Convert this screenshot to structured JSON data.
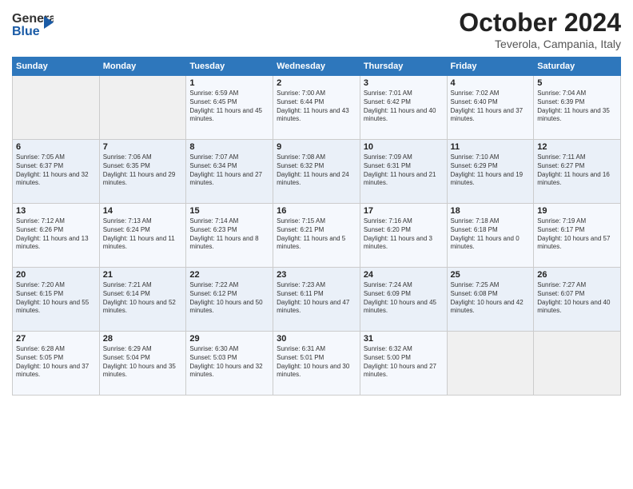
{
  "header": {
    "logo_line1": "General",
    "logo_line2": "Blue",
    "month": "October 2024",
    "location": "Teverola, Campania, Italy"
  },
  "days_of_week": [
    "Sunday",
    "Monday",
    "Tuesday",
    "Wednesday",
    "Thursday",
    "Friday",
    "Saturday"
  ],
  "weeks": [
    [
      {
        "day": "",
        "sunrise": "",
        "sunset": "",
        "daylight": ""
      },
      {
        "day": "",
        "sunrise": "",
        "sunset": "",
        "daylight": ""
      },
      {
        "day": "1",
        "sunrise": "Sunrise: 6:59 AM",
        "sunset": "Sunset: 6:45 PM",
        "daylight": "Daylight: 11 hours and 45 minutes."
      },
      {
        "day": "2",
        "sunrise": "Sunrise: 7:00 AM",
        "sunset": "Sunset: 6:44 PM",
        "daylight": "Daylight: 11 hours and 43 minutes."
      },
      {
        "day": "3",
        "sunrise": "Sunrise: 7:01 AM",
        "sunset": "Sunset: 6:42 PM",
        "daylight": "Daylight: 11 hours and 40 minutes."
      },
      {
        "day": "4",
        "sunrise": "Sunrise: 7:02 AM",
        "sunset": "Sunset: 6:40 PM",
        "daylight": "Daylight: 11 hours and 37 minutes."
      },
      {
        "day": "5",
        "sunrise": "Sunrise: 7:04 AM",
        "sunset": "Sunset: 6:39 PM",
        "daylight": "Daylight: 11 hours and 35 minutes."
      }
    ],
    [
      {
        "day": "6",
        "sunrise": "Sunrise: 7:05 AM",
        "sunset": "Sunset: 6:37 PM",
        "daylight": "Daylight: 11 hours and 32 minutes."
      },
      {
        "day": "7",
        "sunrise": "Sunrise: 7:06 AM",
        "sunset": "Sunset: 6:35 PM",
        "daylight": "Daylight: 11 hours and 29 minutes."
      },
      {
        "day": "8",
        "sunrise": "Sunrise: 7:07 AM",
        "sunset": "Sunset: 6:34 PM",
        "daylight": "Daylight: 11 hours and 27 minutes."
      },
      {
        "day": "9",
        "sunrise": "Sunrise: 7:08 AM",
        "sunset": "Sunset: 6:32 PM",
        "daylight": "Daylight: 11 hours and 24 minutes."
      },
      {
        "day": "10",
        "sunrise": "Sunrise: 7:09 AM",
        "sunset": "Sunset: 6:31 PM",
        "daylight": "Daylight: 11 hours and 21 minutes."
      },
      {
        "day": "11",
        "sunrise": "Sunrise: 7:10 AM",
        "sunset": "Sunset: 6:29 PM",
        "daylight": "Daylight: 11 hours and 19 minutes."
      },
      {
        "day": "12",
        "sunrise": "Sunrise: 7:11 AM",
        "sunset": "Sunset: 6:27 PM",
        "daylight": "Daylight: 11 hours and 16 minutes."
      }
    ],
    [
      {
        "day": "13",
        "sunrise": "Sunrise: 7:12 AM",
        "sunset": "Sunset: 6:26 PM",
        "daylight": "Daylight: 11 hours and 13 minutes."
      },
      {
        "day": "14",
        "sunrise": "Sunrise: 7:13 AM",
        "sunset": "Sunset: 6:24 PM",
        "daylight": "Daylight: 11 hours and 11 minutes."
      },
      {
        "day": "15",
        "sunrise": "Sunrise: 7:14 AM",
        "sunset": "Sunset: 6:23 PM",
        "daylight": "Daylight: 11 hours and 8 minutes."
      },
      {
        "day": "16",
        "sunrise": "Sunrise: 7:15 AM",
        "sunset": "Sunset: 6:21 PM",
        "daylight": "Daylight: 11 hours and 5 minutes."
      },
      {
        "day": "17",
        "sunrise": "Sunrise: 7:16 AM",
        "sunset": "Sunset: 6:20 PM",
        "daylight": "Daylight: 11 hours and 3 minutes."
      },
      {
        "day": "18",
        "sunrise": "Sunrise: 7:18 AM",
        "sunset": "Sunset: 6:18 PM",
        "daylight": "Daylight: 11 hours and 0 minutes."
      },
      {
        "day": "19",
        "sunrise": "Sunrise: 7:19 AM",
        "sunset": "Sunset: 6:17 PM",
        "daylight": "Daylight: 10 hours and 57 minutes."
      }
    ],
    [
      {
        "day": "20",
        "sunrise": "Sunrise: 7:20 AM",
        "sunset": "Sunset: 6:15 PM",
        "daylight": "Daylight: 10 hours and 55 minutes."
      },
      {
        "day": "21",
        "sunrise": "Sunrise: 7:21 AM",
        "sunset": "Sunset: 6:14 PM",
        "daylight": "Daylight: 10 hours and 52 minutes."
      },
      {
        "day": "22",
        "sunrise": "Sunrise: 7:22 AM",
        "sunset": "Sunset: 6:12 PM",
        "daylight": "Daylight: 10 hours and 50 minutes."
      },
      {
        "day": "23",
        "sunrise": "Sunrise: 7:23 AM",
        "sunset": "Sunset: 6:11 PM",
        "daylight": "Daylight: 10 hours and 47 minutes."
      },
      {
        "day": "24",
        "sunrise": "Sunrise: 7:24 AM",
        "sunset": "Sunset: 6:09 PM",
        "daylight": "Daylight: 10 hours and 45 minutes."
      },
      {
        "day": "25",
        "sunrise": "Sunrise: 7:25 AM",
        "sunset": "Sunset: 6:08 PM",
        "daylight": "Daylight: 10 hours and 42 minutes."
      },
      {
        "day": "26",
        "sunrise": "Sunrise: 7:27 AM",
        "sunset": "Sunset: 6:07 PM",
        "daylight": "Daylight: 10 hours and 40 minutes."
      }
    ],
    [
      {
        "day": "27",
        "sunrise": "Sunrise: 6:28 AM",
        "sunset": "Sunset: 5:05 PM",
        "daylight": "Daylight: 10 hours and 37 minutes."
      },
      {
        "day": "28",
        "sunrise": "Sunrise: 6:29 AM",
        "sunset": "Sunset: 5:04 PM",
        "daylight": "Daylight: 10 hours and 35 minutes."
      },
      {
        "day": "29",
        "sunrise": "Sunrise: 6:30 AM",
        "sunset": "Sunset: 5:03 PM",
        "daylight": "Daylight: 10 hours and 32 minutes."
      },
      {
        "day": "30",
        "sunrise": "Sunrise: 6:31 AM",
        "sunset": "Sunset: 5:01 PM",
        "daylight": "Daylight: 10 hours and 30 minutes."
      },
      {
        "day": "31",
        "sunrise": "Sunrise: 6:32 AM",
        "sunset": "Sunset: 5:00 PM",
        "daylight": "Daylight: 10 hours and 27 minutes."
      },
      {
        "day": "",
        "sunrise": "",
        "sunset": "",
        "daylight": ""
      },
      {
        "day": "",
        "sunrise": "",
        "sunset": "",
        "daylight": ""
      }
    ]
  ]
}
